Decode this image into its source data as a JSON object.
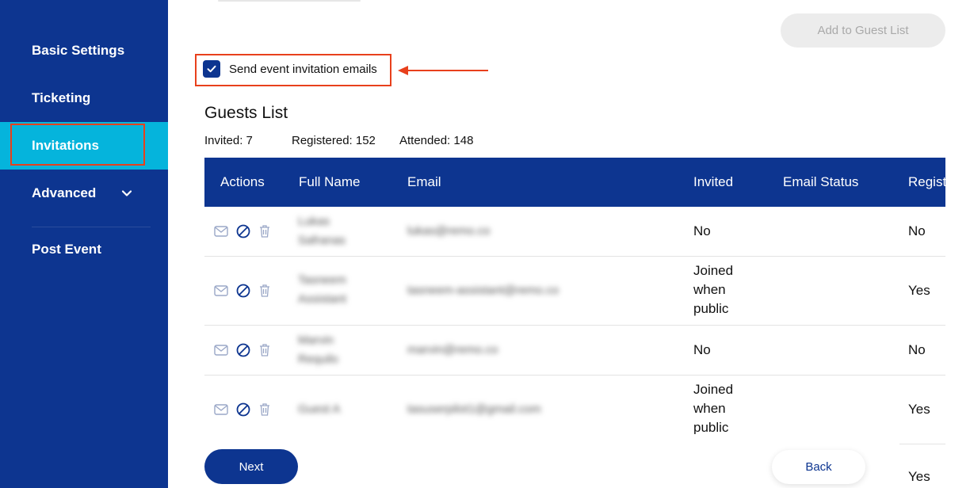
{
  "sidebar": {
    "items": [
      {
        "label": "Basic Settings"
      },
      {
        "label": "Ticketing"
      },
      {
        "label": "Invitations"
      },
      {
        "label": "Advanced"
      },
      {
        "label": "Post Event"
      }
    ],
    "active": "Invitations",
    "colors": {
      "background": "#0d3590",
      "active": "#05b4dc"
    }
  },
  "toolbar": {
    "add_label": "Add to Guest List"
  },
  "invite_option": {
    "label": "Send event invitation emails",
    "checked": true
  },
  "guests": {
    "title": "Guests List",
    "stats": {
      "invited": "Invited: 7",
      "registered": "Registered: 152",
      "attended": "Attended: 148"
    },
    "columns": [
      "Actions",
      "Full Name",
      "Email",
      "Invited",
      "Email Status",
      "Regist"
    ],
    "rows": [
      {
        "name_line1": "Lukas",
        "name_line2": "Safranas",
        "email": "lukas@remo.co",
        "invited": "No",
        "email_status": "",
        "registered": "No"
      },
      {
        "name_line1": "Tasneem",
        "name_line2": "Assistant",
        "email": "tasneem-assistant@remo.co",
        "invited_line1": "Joined",
        "invited_line2": "when",
        "invited_line3": "public",
        "email_status": "",
        "registered": "Yes"
      },
      {
        "name_line1": "Marvin",
        "name_line2": "Requilo",
        "email": "marvin@remo.co",
        "invited": "No",
        "email_status": "",
        "registered": "No"
      },
      {
        "name_line1": "Guest A",
        "email": "tasuserpilot1@gmail.com",
        "invited_line1": "Joined",
        "invited_line2": "when",
        "invited_line3": "public",
        "email_status": "",
        "registered": "Yes"
      }
    ],
    "peek_registered": "Yes"
  },
  "footer": {
    "next_label": "Next",
    "back_label": "Back"
  },
  "icons": [
    "mail-icon",
    "block-icon",
    "trash-icon",
    "checkmark-icon",
    "chevron-down-icon",
    "arrow-left-icon"
  ],
  "colors": {
    "primary": "#0d3590",
    "accent": "#05b4dc",
    "annotation": "#e8401c"
  }
}
